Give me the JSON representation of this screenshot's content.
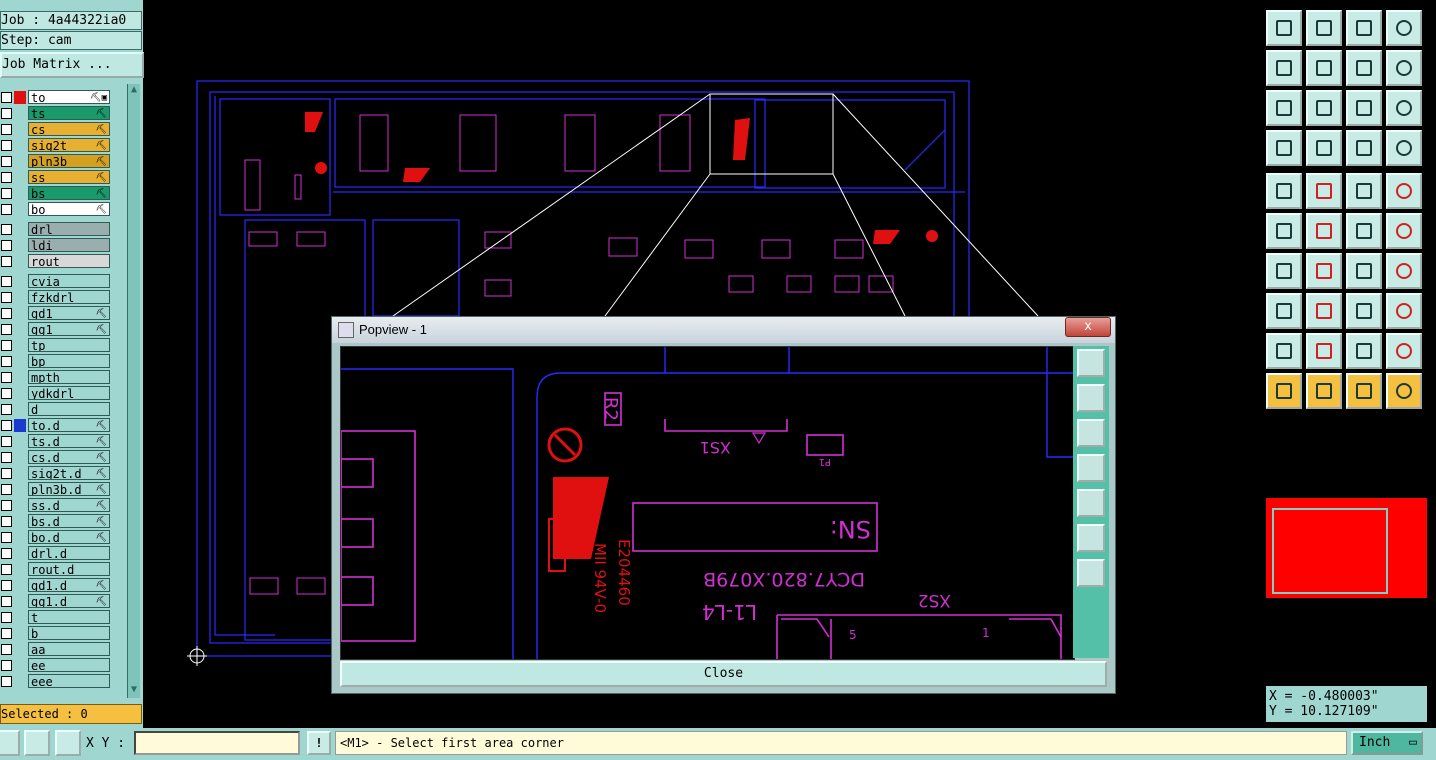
{
  "header": {
    "job": "Job : 4a44322ia0",
    "step": "Step: cam",
    "job_matrix_label": "Job Matrix ..."
  },
  "layers": [
    {
      "name": "to",
      "color": "#e01010",
      "bg": "#ffffff",
      "ext": "⛏▣"
    },
    {
      "name": "ts",
      "color": "",
      "bg": "#1a9a6a",
      "ext": "⛏"
    },
    {
      "name": "cs",
      "color": "",
      "bg": "#e8b030",
      "ext": "⛏"
    },
    {
      "name": "sig2t",
      "color": "",
      "bg": "#e8b030",
      "ext": "⛏"
    },
    {
      "name": "pln3b",
      "color": "",
      "bg": "#d4a020",
      "ext": "⛏"
    },
    {
      "name": "ss",
      "color": "",
      "bg": "#e8b030",
      "ext": "⛏"
    },
    {
      "name": "bs",
      "color": "",
      "bg": "#1a9a6a",
      "ext": "⛏"
    },
    {
      "name": "bo",
      "color": "",
      "bg": "#ffffff",
      "ext": "⛏"
    },
    {
      "name": "drl",
      "color": "",
      "bg": "#9aaeb0",
      "ext": ""
    },
    {
      "name": "ldi",
      "color": "",
      "bg": "#9aaeb0",
      "ext": ""
    },
    {
      "name": "rout",
      "color": "",
      "bg": "#d8d8d8",
      "ext": ""
    },
    {
      "name": "cvia",
      "color": "",
      "bg": "#9fd6cf",
      "ext": ""
    },
    {
      "name": "fzkdrl",
      "color": "",
      "bg": "#9fd6cf",
      "ext": ""
    },
    {
      "name": "gd1",
      "color": "",
      "bg": "#9fd6cf",
      "ext": "⛏"
    },
    {
      "name": "gg1",
      "color": "",
      "bg": "#9fd6cf",
      "ext": "⛏"
    },
    {
      "name": "tp",
      "color": "",
      "bg": "#9fd6cf",
      "ext": ""
    },
    {
      "name": "bp",
      "color": "",
      "bg": "#9fd6cf",
      "ext": ""
    },
    {
      "name": "mpth",
      "color": "",
      "bg": "#9fd6cf",
      "ext": ""
    },
    {
      "name": "ydkdrl",
      "color": "",
      "bg": "#9fd6cf",
      "ext": ""
    },
    {
      "name": "d",
      "color": "",
      "bg": "#9fd6cf",
      "ext": ""
    },
    {
      "name": "to.d",
      "color": "#1a3ad0",
      "bg": "#9fd6cf",
      "ext": "⛏"
    },
    {
      "name": "ts.d",
      "color": "",
      "bg": "#9fd6cf",
      "ext": "⛏"
    },
    {
      "name": "cs.d",
      "color": "",
      "bg": "#9fd6cf",
      "ext": "⛏"
    },
    {
      "name": "sig2t.d",
      "color": "",
      "bg": "#9fd6cf",
      "ext": "⛏"
    },
    {
      "name": "pln3b.d",
      "color": "",
      "bg": "#9fd6cf",
      "ext": "⛏"
    },
    {
      "name": "ss.d",
      "color": "",
      "bg": "#9fd6cf",
      "ext": "⛏"
    },
    {
      "name": "bs.d",
      "color": "",
      "bg": "#9fd6cf",
      "ext": "⛏"
    },
    {
      "name": "bo.d",
      "color": "",
      "bg": "#9fd6cf",
      "ext": "⛏"
    },
    {
      "name": "drl.d",
      "color": "",
      "bg": "#9fd6cf",
      "ext": ""
    },
    {
      "name": "rout.d",
      "color": "",
      "bg": "#9fd6cf",
      "ext": ""
    },
    {
      "name": "gd1.d",
      "color": "",
      "bg": "#9fd6cf",
      "ext": "⛏"
    },
    {
      "name": "gg1.d",
      "color": "",
      "bg": "#9fd6cf",
      "ext": "⛏"
    },
    {
      "name": "t",
      "color": "",
      "bg": "#9fd6cf",
      "ext": ""
    },
    {
      "name": "b",
      "color": "",
      "bg": "#9fd6cf",
      "ext": ""
    },
    {
      "name": "aa",
      "color": "",
      "bg": "#9fd6cf",
      "ext": ""
    },
    {
      "name": "ee",
      "color": "",
      "bg": "#9fd6cf",
      "ext": ""
    },
    {
      "name": "eee",
      "color": "",
      "bg": "#9fd6cf",
      "ext": ""
    }
  ],
  "selected_label": "Selected : 0",
  "popview": {
    "title": "Popview - 1",
    "close_x": "x",
    "close_label": "Close",
    "zoom_texts": {
      "r2": "R2",
      "xs1": "XS1",
      "p1": "P1",
      "sn": "SN:",
      "partno": "DCY7.820.X079B",
      "layers": "L1-L4",
      "xs2": "XS2",
      "ul": "E204460",
      "ul2": "MII 94V-0",
      "pin5": "5",
      "pin1": "1"
    }
  },
  "coords": {
    "x": "X = -0.480003\"",
    "y": "Y = 10.127109\""
  },
  "bottom": {
    "xy_label": "X Y :",
    "xy_value": "",
    "warn_glyph": "!",
    "status": "<M1> - Select first area corner",
    "units": "Inch"
  },
  "colors": {
    "panel": "#9fd6cf",
    "pcb_outline": "#2a2aff",
    "silkscreen": "#d22fd2",
    "logo": "#e01010"
  }
}
